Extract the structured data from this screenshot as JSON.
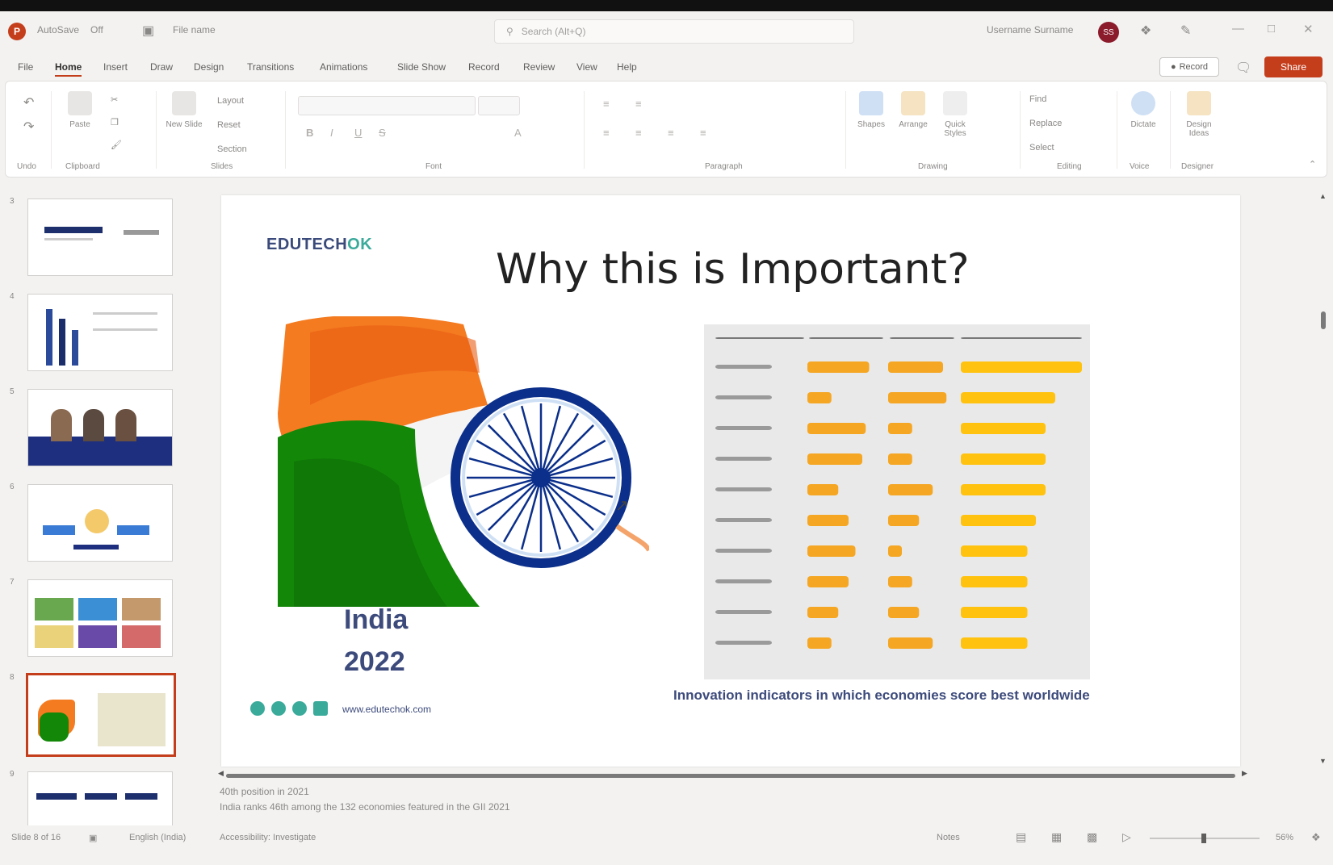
{
  "titlebar": {
    "autosave_label": "AutoSave",
    "autosave_state": "Off",
    "file_name": "File name",
    "search_placeholder": "Search (Alt+Q)",
    "user_name": "Username Surname",
    "avatar_initials": "SS"
  },
  "menu": {
    "items": [
      "File",
      "Home",
      "Insert",
      "Draw",
      "Design",
      "Transitions",
      "Animations",
      "Slide Show",
      "Record",
      "Review",
      "View",
      "Help"
    ],
    "active": "Home",
    "record_label": "Record",
    "share_label": "Share"
  },
  "ribbon": {
    "groups": [
      "Undo",
      "Clipboard",
      "Slides",
      "Font",
      "Paragraph",
      "Drawing",
      "Editing",
      "Voice",
      "Designer"
    ],
    "paste_label": "Paste",
    "new_slide_label": "New Slide",
    "layout_label": "Layout",
    "reset_label": "Reset",
    "section_label": "Section",
    "shapes_label": "Shapes",
    "arrange_label": "Arrange",
    "quick_styles_label": "Quick Styles",
    "find_label": "Find",
    "replace_label": "Replace",
    "select_label": "Select",
    "dictate_label": "Dictate",
    "designer_label": "Design Ideas"
  },
  "thumbnails": [
    {
      "num": "3"
    },
    {
      "num": "4"
    },
    {
      "num": "5"
    },
    {
      "num": "6"
    },
    {
      "num": "7"
    },
    {
      "num": "8"
    },
    {
      "num": "9"
    }
  ],
  "slide": {
    "brand": "EDUTECH",
    "brand_accent": "OK",
    "title": "Why this is Important?",
    "india_line1": "India",
    "india_line2": "2022",
    "website": "www.edutechok.com",
    "caption": "Innovation indicators in which economies score best worldwide"
  },
  "notes": {
    "line1": "40th position in 2021",
    "line2": "India ranks 46th among the 132 economies featured in the GII 2021"
  },
  "status": {
    "slide_of": "Slide 8 of 16",
    "language": "English (India)",
    "accessibility": "Accessibility: Investigate",
    "notes_label": "Notes",
    "zoom": "56%"
  },
  "colors": {
    "accent": "#c43e1c",
    "saffron": "#f47b20",
    "green": "#138808",
    "chakra": "#0b2f8a",
    "bar_orange": "#f5a623",
    "bar_yellow": "#ffc20e"
  }
}
